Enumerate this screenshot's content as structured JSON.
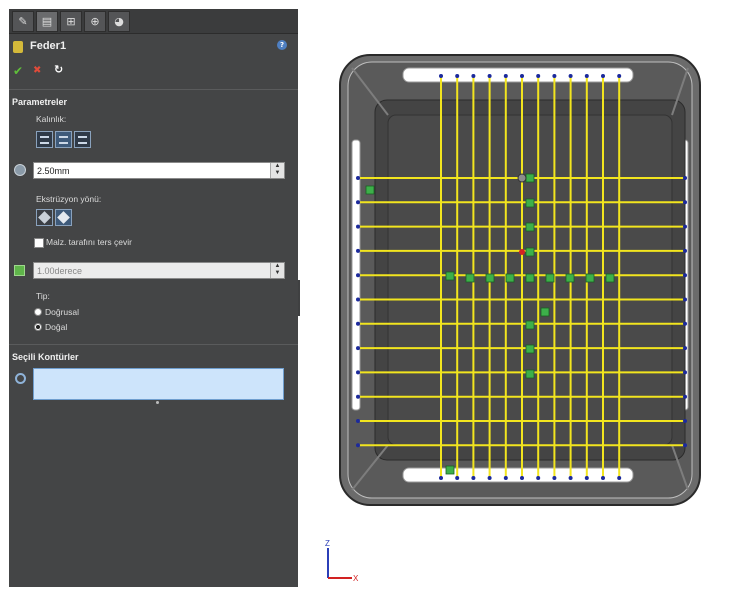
{
  "tabs": [
    {
      "name": "feature-manager-tab",
      "icon": "feature-tree-icon",
      "glyph": "✎"
    },
    {
      "name": "property-manager-tab",
      "icon": "property-manager-icon",
      "glyph": "▤"
    },
    {
      "name": "configuration-manager-tab",
      "icon": "configuration-icon",
      "glyph": "⊞"
    },
    {
      "name": "dimxpert-tab",
      "icon": "crosshair-icon",
      "glyph": "⊕"
    },
    {
      "name": "display-manager-tab",
      "icon": "appearance-icon",
      "glyph": "◕"
    }
  ],
  "feature": {
    "title": "Feder1",
    "help_glyph": "?",
    "ok_glyph": "✔",
    "cancel_glyph": "✖",
    "pin_glyph": "↻"
  },
  "parameters": {
    "heading": "Parametreler",
    "thickness_label": "Kalınlık:",
    "thickness_value": "2.50mm",
    "direction_label": "Ekstrüzyon yönü:",
    "flip_label": "Malz. tarafını ters çevir",
    "draft_value": "1.00derece",
    "type_label": "Tip:",
    "type_options": [
      "Doğrusal",
      "Doğal"
    ],
    "type_selected": "Doğal"
  },
  "contours": {
    "heading": "Seçili Kontürler",
    "selection_value": ""
  },
  "triad": {
    "z": "Z",
    "x": "X"
  },
  "colors": {
    "panel_bg": "#444546",
    "rib_color": "#f2e51e",
    "sketch_point": "#1c2a9c",
    "selection_bg": "#cde4fb",
    "model_gray": "#5b5b5b"
  },
  "model": {
    "horizontal_ribs": 12,
    "vertical_ribs": 12
  }
}
